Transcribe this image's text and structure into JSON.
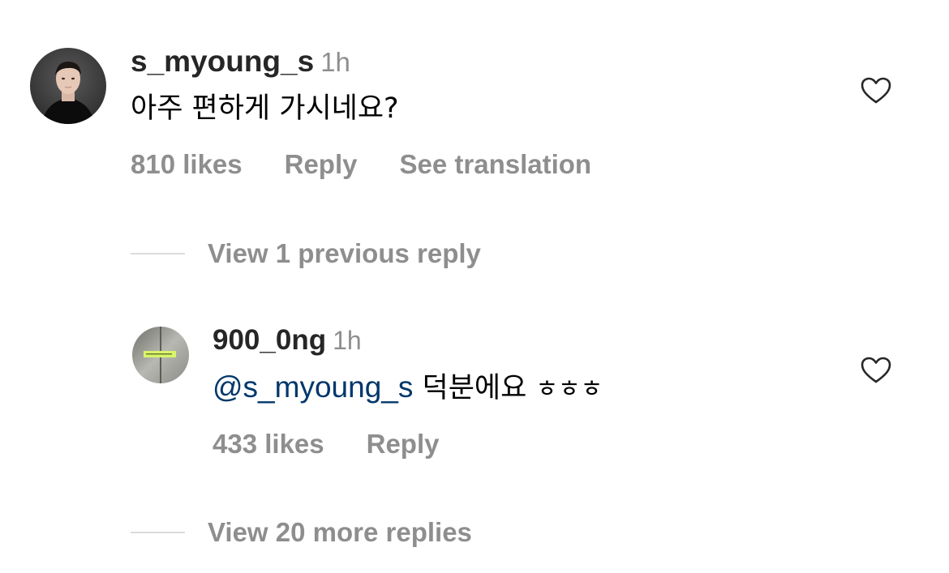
{
  "comment": {
    "username": "s_myoung_s",
    "time": "1h",
    "text": "아주 편하게 가시네요?",
    "likes": "810 likes",
    "reply_label": "Reply",
    "translate_label": "See translation",
    "avatar_icon": "profile-photo-man-black-turtleneck"
  },
  "view_previous": "View 1 previous reply",
  "reply": {
    "username": "900_0ng",
    "time": "1h",
    "mention": "@s_myoung_s",
    "text": "덕분에요",
    "jamo": "ㅎㅎㅎ",
    "likes": "433 likes",
    "reply_label": "Reply",
    "avatar_icon": "profile-photo-elevator-wall"
  },
  "view_more": "View 20 more replies",
  "icons": {
    "like": "heart-outline-icon"
  },
  "colors": {
    "username": "#262626",
    "secondary_text": "#8e8e8e",
    "mention": "#00376b",
    "divider": "#dbdbdb"
  }
}
